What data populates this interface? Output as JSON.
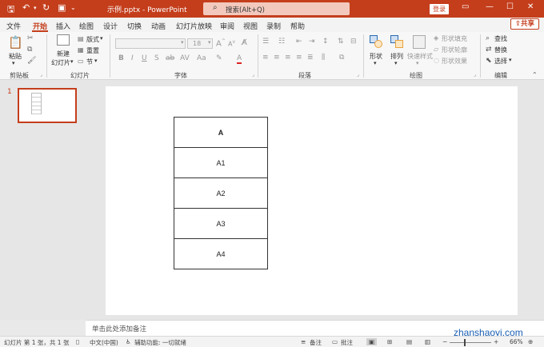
{
  "titlebar": {
    "doc_title": "示例.pptx - PowerPoint",
    "search_placeholder": "搜索(Alt+Q)",
    "login_label": "登录",
    "accent_color": "#c43e1c"
  },
  "tabs": [
    "文件",
    "开始",
    "插入",
    "绘图",
    "设计",
    "切换",
    "动画",
    "幻灯片放映",
    "审阅",
    "视图",
    "录制",
    "帮助"
  ],
  "share_label": "共享",
  "ribbon": {
    "clipboard": {
      "label": "剪贴板",
      "paste": "粘贴"
    },
    "slides": {
      "label": "幻灯片",
      "new_slide_line1": "新建",
      "new_slide_line2": "幻灯片",
      "layout": "版式",
      "reset": "重置",
      "section": "节"
    },
    "font": {
      "label": "字体",
      "size": "18"
    },
    "paragraph": {
      "label": "段落"
    },
    "drawing": {
      "label": "绘图",
      "shapes": "形状",
      "arrange": "排列",
      "quick_styles": "快速样式",
      "fill": "形状填充",
      "outline": "形状轮廓",
      "effects": "形状效果"
    },
    "editing": {
      "label": "编辑",
      "find": "查找",
      "replace": "替换",
      "select": "选择"
    }
  },
  "thumbnail": {
    "number": "1"
  },
  "table_rows": [
    "A",
    "A1",
    "A2",
    "A3",
    "A4"
  ],
  "notes_placeholder": "单击此处添加备注",
  "status": {
    "slide_info": "幻灯片 第 1 张，共 1 张",
    "language": "中文(中国)",
    "accessibility": "辅助功能: 一切就绪",
    "notes": "备注",
    "comments": "批注",
    "zoom": "66%"
  },
  "watermark": "zhanshaoyi.com"
}
